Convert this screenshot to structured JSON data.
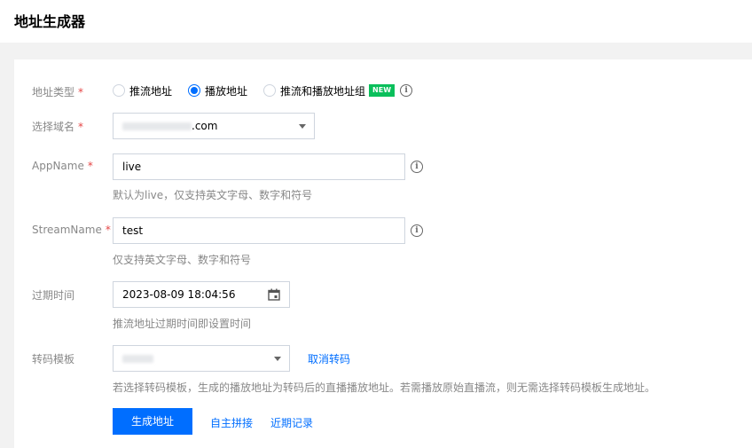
{
  "header": {
    "title": "地址生成器"
  },
  "form": {
    "address_type": {
      "label": "地址类型",
      "required_mark": "*",
      "options": [
        {
          "label": "推流地址",
          "checked": false
        },
        {
          "label": "播放地址",
          "checked": true
        },
        {
          "label": "推流和播放地址组",
          "checked": false
        }
      ],
      "new_badge": "NEW"
    },
    "domain": {
      "label": "选择域名",
      "required_mark": "*",
      "value": ".com"
    },
    "app_name": {
      "label": "AppName",
      "required_mark": "*",
      "value": "live",
      "hint": "默认为live，仅支持英文字母、数字和符号"
    },
    "stream_name": {
      "label": "StreamName",
      "required_mark": "*",
      "value": "test",
      "hint": "仅支持英文字母、数字和符号"
    },
    "expire_time": {
      "label": "过期时间",
      "value": "2023-08-09 18:04:56",
      "hint": "推流地址过期时间即设置时间"
    },
    "transcode_template": {
      "label": "转码模板",
      "cancel_link": "取消转码",
      "hint": "若选择转码模板，生成的播放地址为转码后的直播播放地址。若需播放原始直播流，则无需选择转码模板生成地址。"
    },
    "actions": {
      "generate_label": "生成地址",
      "custom_label": "自主拼接",
      "recent_label": "近期记录"
    }
  },
  "colors": {
    "primary": "#006eff",
    "required": "#e54545",
    "new_badge": "#0abf5b",
    "hint": "#888888"
  }
}
